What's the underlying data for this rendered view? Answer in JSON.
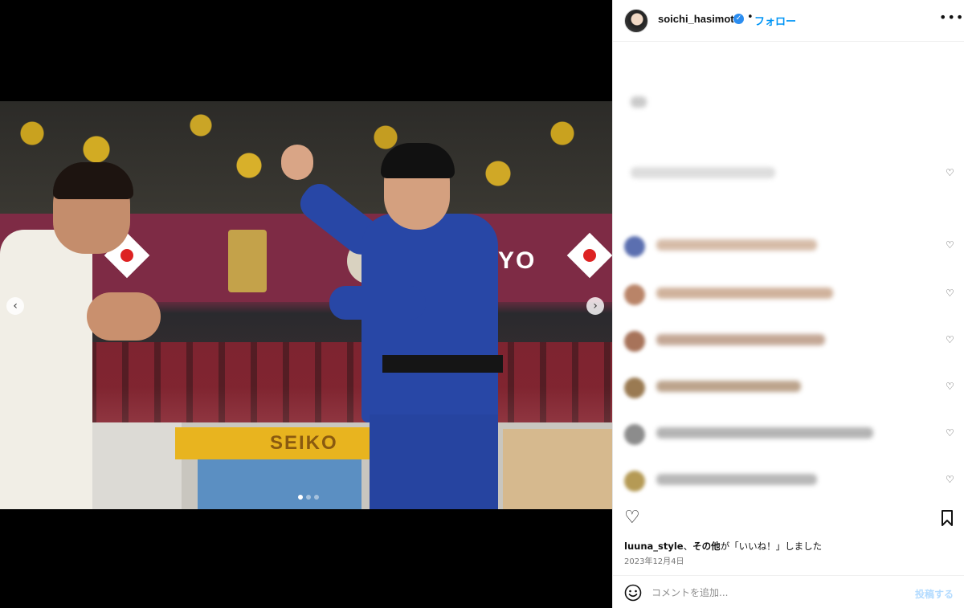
{
  "photo": {
    "banner_text": "YO",
    "scoreboard_sponsor": "SEIKO",
    "board_letter": "S",
    "carousel": {
      "slides": 3,
      "active_index": 0
    }
  },
  "header": {
    "username": "soichi_hasimoto",
    "verified": true,
    "separator": "•",
    "follow_label": "フォロー",
    "more_icon": "more-horizontal-icon"
  },
  "comments": {
    "count_visible": 9,
    "content_obscured": true
  },
  "actions": {
    "like_icon": "heart-outline-icon",
    "save_icon": "bookmark-icon"
  },
  "likes": {
    "user": "luuna_style",
    "mid": "、",
    "others": "その他",
    "suffix": "が「いいね！」しました"
  },
  "date": "2023年12月4日",
  "add_comment": {
    "placeholder": "コメントを追加...",
    "post_label": "投稿する"
  },
  "colors": {
    "accent": "#0095f6",
    "verified": "#2b8df0",
    "post_disabled": "#b3dbff"
  }
}
